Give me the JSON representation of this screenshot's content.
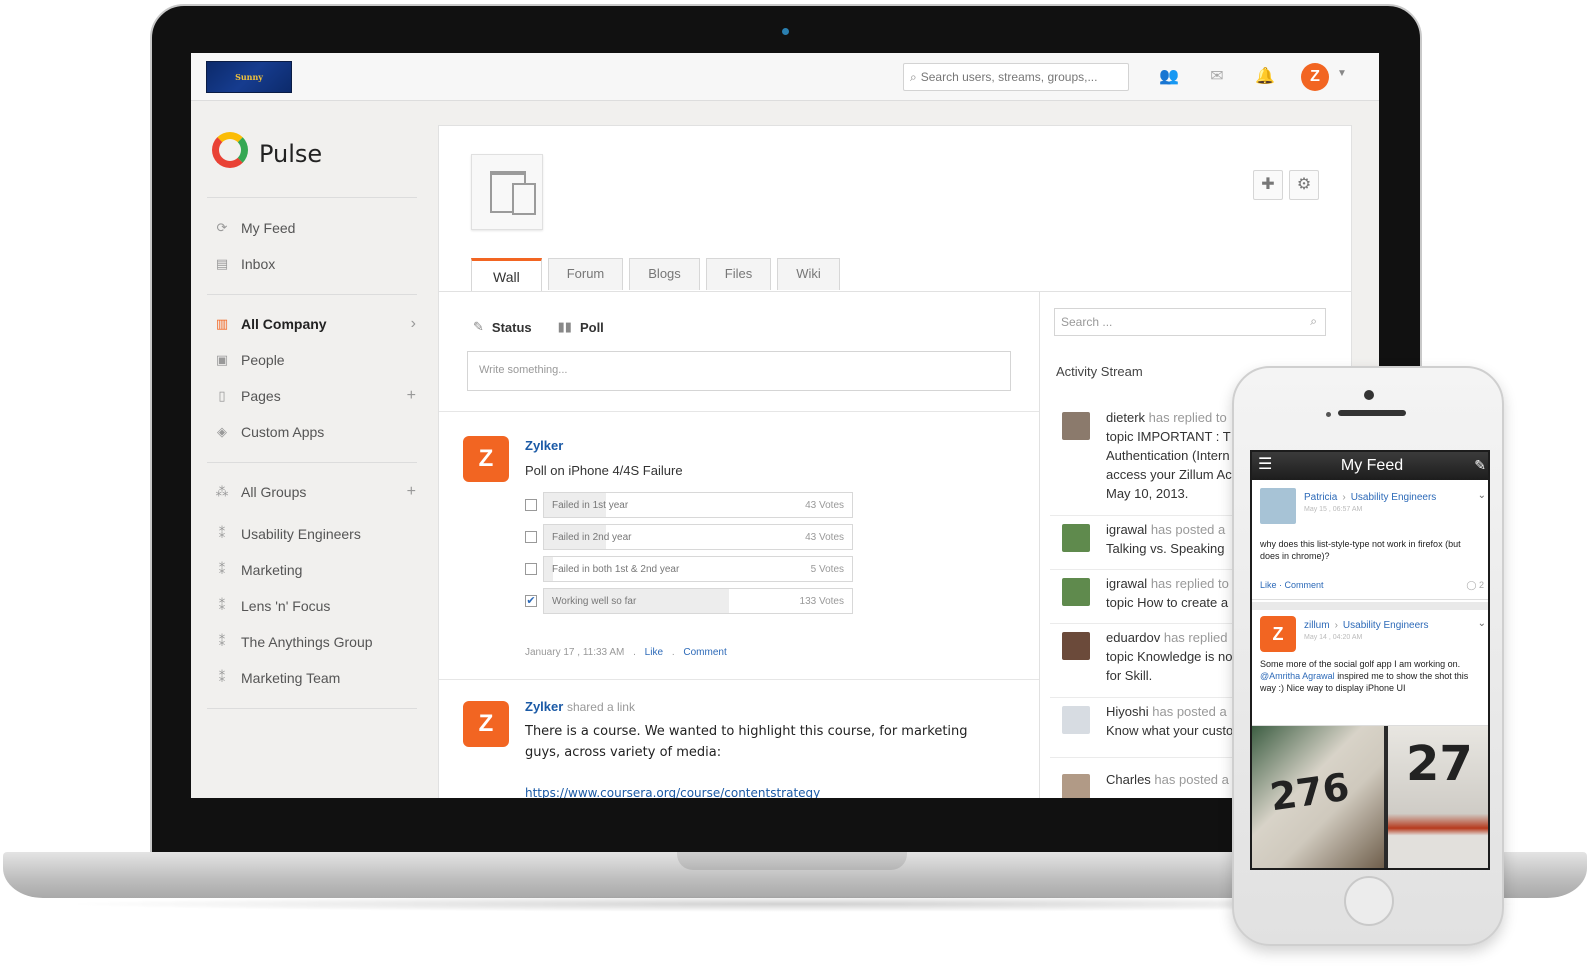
{
  "header": {
    "company_logo_text": "Sunny",
    "search_placeholder": "Search users, streams, groups,...",
    "avatar_letter": "Z"
  },
  "brand": {
    "name": "Pulse",
    "accent": "#f26522",
    "link": "#1b5aa6"
  },
  "sidebar": {
    "top_items": [
      {
        "label": "My Feed",
        "icon": "feed-icon"
      },
      {
        "label": "Inbox",
        "icon": "inbox-icon"
      }
    ],
    "company_items": [
      {
        "label": "All Company",
        "icon": "building-icon",
        "active": true,
        "right": "›"
      },
      {
        "label": "People",
        "icon": "people-icon"
      },
      {
        "label": "Pages",
        "icon": "page-icon",
        "right": "+"
      },
      {
        "label": "Custom Apps",
        "icon": "apps-icon"
      }
    ],
    "groups_header": {
      "label": "All Groups",
      "right": "+"
    },
    "groups": [
      {
        "label": "Usability Engineers"
      },
      {
        "label": "Marketing"
      },
      {
        "label": "Lens 'n' Focus"
      },
      {
        "label": "The Anythings Group"
      },
      {
        "label": "Marketing Team"
      }
    ]
  },
  "tabs": [
    "Wall",
    "Forum",
    "Blogs",
    "Files",
    "Wiki"
  ],
  "composer": {
    "status_label": "Status",
    "poll_label": "Poll",
    "placeholder": "Write something..."
  },
  "posts": [
    {
      "avatar": "Z",
      "author": "Zylker",
      "title": "Poll on iPhone 4/4S Failure",
      "poll": [
        {
          "label": "Failed in 1st year",
          "votes": "43 Votes",
          "share": 0.2,
          "checked": false
        },
        {
          "label": "Failed in 2nd year",
          "votes": "43 Votes",
          "share": 0.2,
          "checked": false
        },
        {
          "label": "Failed in both 1st & 2nd year",
          "votes": "5 Votes",
          "share": 0.03,
          "checked": false
        },
        {
          "label": "Working well so far",
          "votes": "133 Votes",
          "share": 0.6,
          "checked": true
        }
      ],
      "time": "January 17 , 11:33 AM",
      "like": "Like",
      "comment": "Comment"
    },
    {
      "avatar": "Z",
      "author": "Zylker",
      "action": "shared a link",
      "body_line1": "There is a course. We wanted to highlight this course, for marketing",
      "body_line2": "guys, across variety of media:",
      "link": "https://www.coursera.org/course/contentstrategy"
    }
  ],
  "activity": {
    "search_placeholder": "Search ...",
    "title": "Activity Stream",
    "items": [
      {
        "user": "dieterk",
        "action": "has replied to",
        "lines": [
          "topic IMPORTANT : T",
          "Authentication (Intern",
          "access your Zillum Ac",
          "May 10, 2013."
        ]
      },
      {
        "user": "igrawal",
        "action": "has posted a",
        "lines": [
          "Talking vs. Speaking"
        ]
      },
      {
        "user": "igrawal",
        "action": "has replied to",
        "lines": [
          "topic How to create a"
        ]
      },
      {
        "user": "eduardov",
        "action": "has replied",
        "lines": [
          "topic Knowledge is no",
          "for Skill."
        ]
      },
      {
        "user": "Hiyoshi",
        "action": "has posted a",
        "lines": [
          "Know what your custo"
        ]
      },
      {
        "user": "Charles",
        "action": "has posted a",
        "lines": []
      }
    ]
  },
  "phone": {
    "title": "My Feed",
    "post1": {
      "author": "Patricia",
      "group": "Usability Engineers",
      "time": "May 15 , 06:57 AM",
      "body": "why does this list-style-type not work in firefox (but does in chrome)?",
      "like": "Like",
      "comment": "Comment",
      "count": "2"
    },
    "post2": {
      "avatar": "Z",
      "author": "zillum",
      "group": "Usability Engineers",
      "time": "May 14 , 04:20 AM",
      "body_start": "Some more of the social golf app I am working on.",
      "mention": "@Amritha Agrawal",
      "body_end": "inspired me to show the shot this way :) Nice way to display iPhone UI"
    },
    "photo_left_number": "276",
    "photo_right_number": "27"
  }
}
